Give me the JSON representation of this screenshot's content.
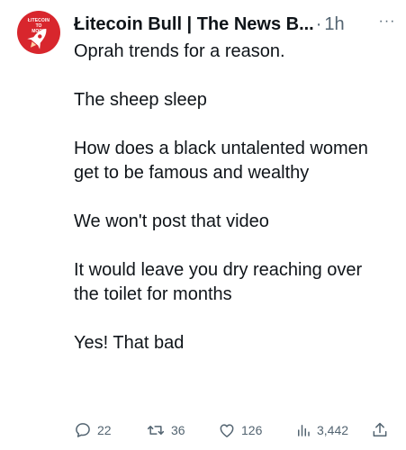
{
  "tweet": {
    "author": {
      "display_name": "Łitecoin Bull | The News B...",
      "avatar_text": [
        "ŁITECOIN",
        "TO",
        "MOON"
      ],
      "avatar_color": "#d8262d"
    },
    "separator": "·",
    "time": "1h",
    "more_label": "···",
    "body_paragraphs": [
      "Oprah trends for a reason.",
      "The sheep sleep",
      "How does a black untalented women get to be famous and wealthy",
      "We won't post that video",
      "It would leave you dry reaching over the toilet for months",
      "Yes! That bad"
    ],
    "actions": {
      "reply_icon": "reply-icon",
      "reply_count": "22",
      "retweet_icon": "retweet-icon",
      "retweet_count": "36",
      "like_icon": "heart-icon",
      "like_count": "126",
      "views_icon": "views-icon",
      "views_count": "3,442",
      "share_icon": "share-icon"
    }
  },
  "colors": {
    "text": "#0f1419",
    "secondary": "#536471",
    "background": "#ffffff"
  }
}
